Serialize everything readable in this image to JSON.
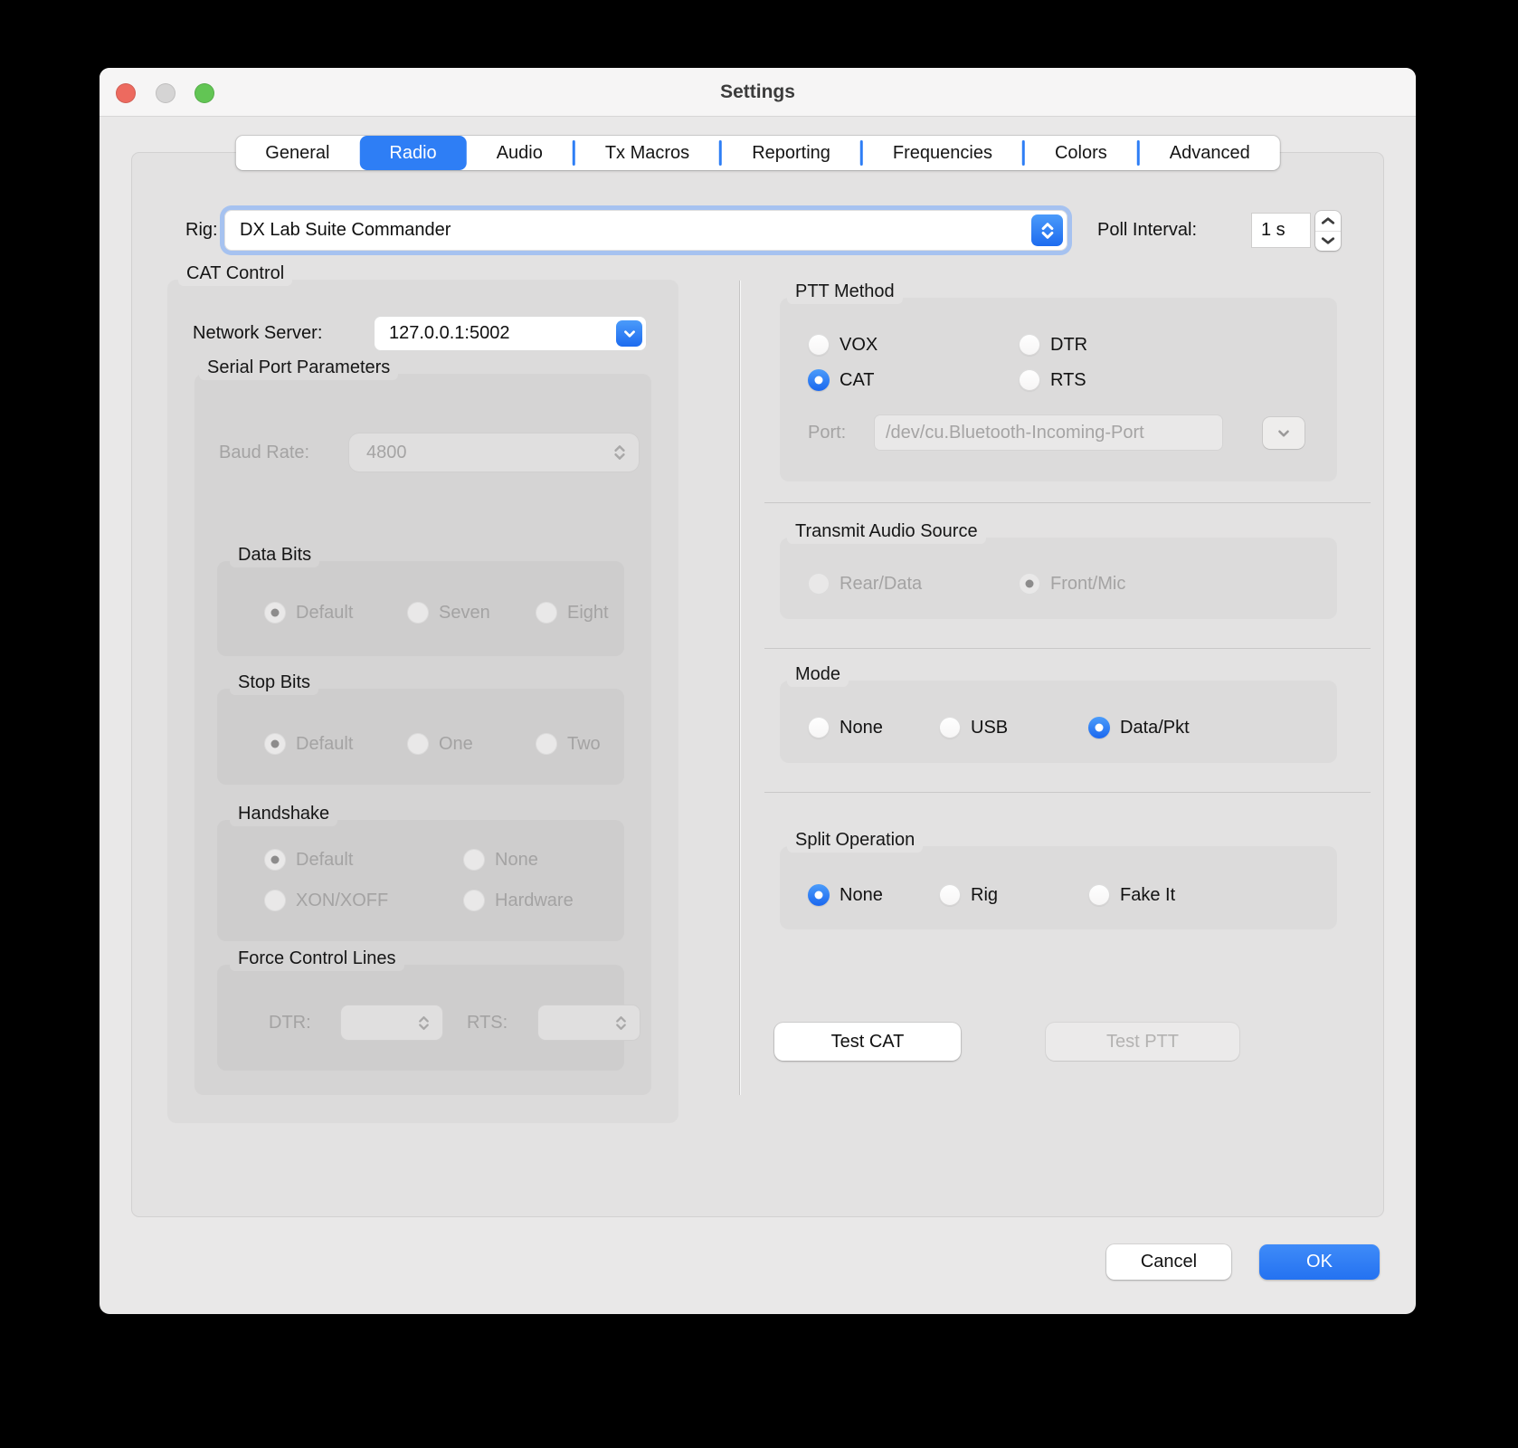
{
  "window": {
    "title": "Settings"
  },
  "tabs": {
    "items": [
      {
        "label": "General"
      },
      {
        "label": "Radio",
        "selected": true
      },
      {
        "label": "Audio"
      },
      {
        "label": "Tx Macros"
      },
      {
        "label": "Reporting"
      },
      {
        "label": "Frequencies"
      },
      {
        "label": "Colors"
      },
      {
        "label": "Advanced"
      }
    ]
  },
  "rig": {
    "label": "Rig:",
    "value": "DX Lab Suite Commander"
  },
  "poll_interval": {
    "label": "Poll Interval:",
    "value": "1 s"
  },
  "cat_control": {
    "title": "CAT Control",
    "network_server": {
      "label": "Network Server:",
      "value": "127.0.0.1:5002"
    },
    "serial_port_parameters": {
      "title": "Serial Port Parameters",
      "baud_rate": {
        "label": "Baud Rate:",
        "value": "4800",
        "disabled": true
      },
      "data_bits": {
        "title": "Data Bits",
        "disabled": true,
        "options": [
          {
            "label": "Default",
            "selected": true
          },
          {
            "label": "Seven"
          },
          {
            "label": "Eight"
          }
        ]
      },
      "stop_bits": {
        "title": "Stop Bits",
        "disabled": true,
        "options": [
          {
            "label": "Default",
            "selected": true
          },
          {
            "label": "One"
          },
          {
            "label": "Two"
          }
        ]
      },
      "handshake": {
        "title": "Handshake",
        "disabled": true,
        "options": [
          {
            "label": "Default",
            "selected": true
          },
          {
            "label": "None"
          },
          {
            "label": "XON/XOFF"
          },
          {
            "label": "Hardware"
          }
        ]
      },
      "force_control_lines": {
        "title": "Force Control Lines",
        "disabled": true,
        "dtr_label": "DTR:",
        "dtr_value": "",
        "rts_label": "RTS:",
        "rts_value": ""
      }
    }
  },
  "ptt_method": {
    "title": "PTT Method",
    "options": [
      {
        "label": "VOX"
      },
      {
        "label": "CAT",
        "selected": true
      },
      {
        "label": "DTR"
      },
      {
        "label": "RTS"
      }
    ],
    "port": {
      "label": "Port:",
      "value": "/dev/cu.Bluetooth-Incoming-Port",
      "disabled": true
    }
  },
  "transmit_audio_source": {
    "title": "Transmit Audio Source",
    "disabled": true,
    "options": [
      {
        "label": "Rear/Data"
      },
      {
        "label": "Front/Mic",
        "selected": true
      }
    ]
  },
  "mode": {
    "title": "Mode",
    "options": [
      {
        "label": "None"
      },
      {
        "label": "USB"
      },
      {
        "label": "Data/Pkt",
        "selected": true
      }
    ]
  },
  "split_operation": {
    "title": "Split Operation",
    "options": [
      {
        "label": "None",
        "selected": true
      },
      {
        "label": "Rig"
      },
      {
        "label": "Fake It"
      }
    ]
  },
  "actions": {
    "test_cat": "Test CAT",
    "test_ptt": "Test PTT",
    "test_ptt_disabled": true
  },
  "footer": {
    "cancel": "Cancel",
    "ok": "OK"
  },
  "icons": {
    "traffic": [
      "close-icon",
      "minimize-icon",
      "zoom-icon"
    ],
    "controls": [
      "chevron-up-down-icon",
      "chevron-down-icon",
      "stepper-up-icon",
      "stepper-down-icon"
    ]
  },
  "colors": {
    "accent": "#2e7ef5",
    "selected_radio": "#1a67ef",
    "traffic_close": "#ed6a5f",
    "traffic_minimize": "#d5d4d4",
    "traffic_zoom": "#62c554"
  }
}
